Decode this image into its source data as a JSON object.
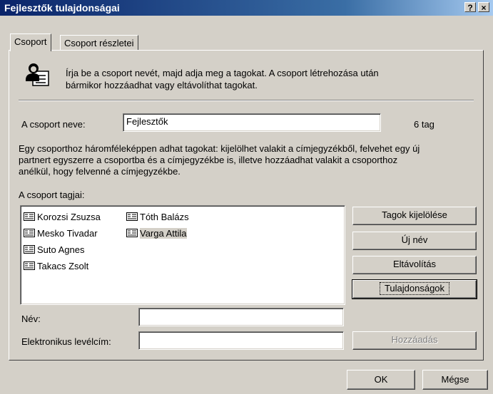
{
  "window": {
    "title": "Fejlesztők tulajdonságai",
    "help_button": "?",
    "close_button": "×"
  },
  "tabs": [
    {
      "label": "Csoport",
      "active": true
    },
    {
      "label": "Csoport részletei",
      "active": false
    }
  ],
  "info": {
    "icon": "people-address-book-icon",
    "line1": "Írja be a csoport nevét, majd adja meg a tagokat. A csoport létrehozása után",
    "line2": "bármikor hozzáadhat vagy eltávolíthat tagokat."
  },
  "group_name": {
    "label": "A csoport neve:",
    "value": "Fejlesztők",
    "count": "6 tag"
  },
  "description": {
    "line1": "Egy csoporthoz háromféleképpen adhat tagokat: kijelölhet valakit a címjegyzékből, felvehet egy új",
    "line2": "partnert egyszerre a csoportba és a címjegyzékbe is, illetve hozzáadhat valakit a csoporthoz",
    "line3": "anélkül, hogy felvenné a címjegyzékbe."
  },
  "members": {
    "label": "A csoport tagjai:",
    "items": [
      {
        "name": "Korozsi Zsuzsa",
        "selected": false
      },
      {
        "name": "Mesko Tivadar",
        "selected": false
      },
      {
        "name": "Suto Agnes",
        "selected": false
      },
      {
        "name": "Takacs Zsolt",
        "selected": false
      },
      {
        "name": "Tóth Balázs",
        "selected": false
      },
      {
        "name": "Varga Attila",
        "selected": true
      }
    ]
  },
  "buttons": {
    "select_members": "Tagok kijelölése",
    "new_name": "Új név",
    "remove": "Eltávolítás",
    "properties": "Tulajdonságok",
    "add": "Hozzáadás",
    "ok": "OK",
    "cancel": "Mégse"
  },
  "form": {
    "name_label": "Név:",
    "name_value": "",
    "email_label": "Elektronikus levélcím:",
    "email_value": ""
  }
}
